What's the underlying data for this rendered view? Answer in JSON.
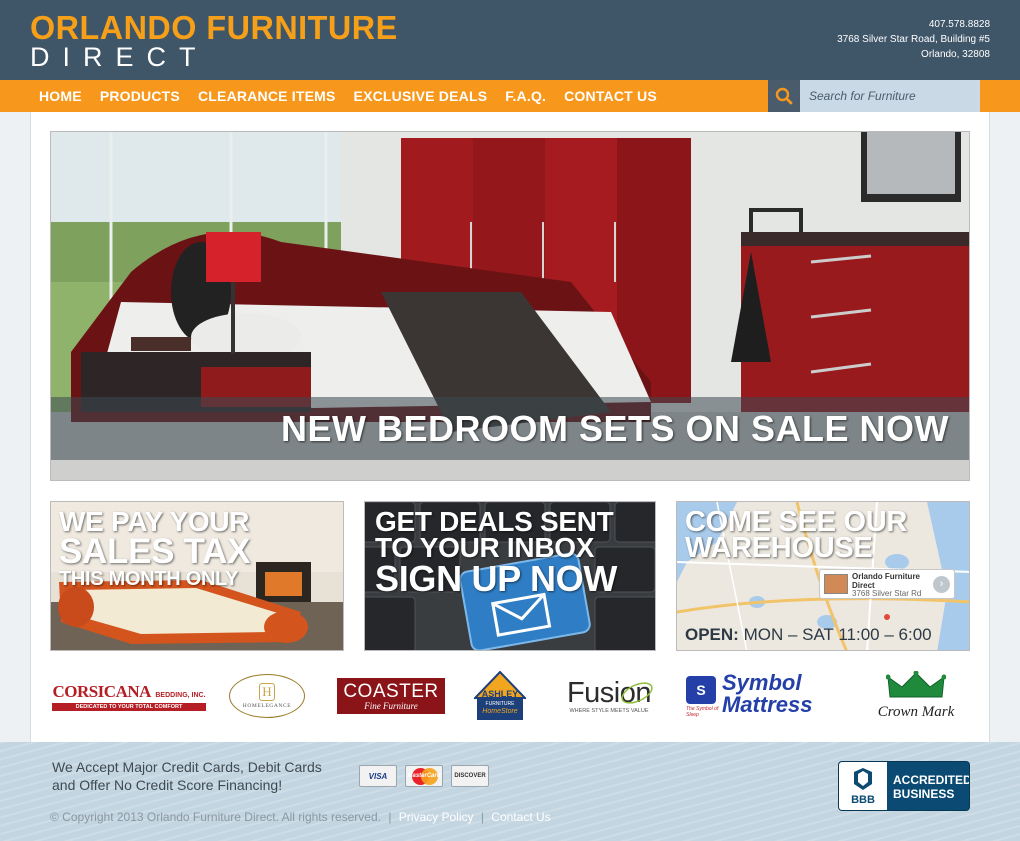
{
  "header": {
    "logo_line1": "ORLANDO FURNITURE",
    "logo_line2": "DIRECT",
    "phone": "407.578.8828",
    "address_line1": "3768 Silver Star Road, Building #5",
    "address_line2": "Orlando, 32808"
  },
  "nav": {
    "items": [
      {
        "label": "HOME"
      },
      {
        "label": "PRODUCTS"
      },
      {
        "label": "CLEARANCE ITEMS"
      },
      {
        "label": "EXCLUSIVE DEALS"
      },
      {
        "label": "F.A.Q."
      },
      {
        "label": "CONTACT US"
      }
    ]
  },
  "search": {
    "placeholder": "Search for Furniture",
    "icon": "search-icon"
  },
  "hero": {
    "caption": "NEW BEDROOM SETS ON SALE NOW"
  },
  "promos": {
    "tax": {
      "line1": "WE PAY YOUR",
      "line2": "SALES TAX",
      "line3": "THIS MONTH ONLY"
    },
    "deals": {
      "line1": "GET DEALS SENT",
      "line2": "TO YOUR INBOX",
      "line3": "SIGN UP NOW"
    },
    "warehouse": {
      "line1": "COME SEE OUR",
      "line2": "WAREHOUSE",
      "hours_label": "OPEN:",
      "hours_value": "MON – SAT 11:00 – 6:00",
      "map_pin_title": "Orlando Furniture Direct",
      "map_pin_address": "3768 Silver Star Rd"
    }
  },
  "brands": [
    {
      "name": "CORSICANA",
      "suffix": "BEDDING, INC.",
      "tagline": "DEDICATED TO YOUR TOTAL COMFORT"
    },
    {
      "name": "HOMELEGANCE"
    },
    {
      "name": "COASTER",
      "tagline": "Fine Furniture"
    },
    {
      "name": "ASHLEY",
      "sub1": "FURNITURE",
      "sub2": "HomeStore"
    },
    {
      "name": "Fusion",
      "tagline": "WHERE STYLE MEETS VALUE"
    },
    {
      "name": "Symbol",
      "name2": "Mattress",
      "tagline": "The Symbol of Sleep"
    },
    {
      "name": "Crown Mark"
    }
  ],
  "footer": {
    "payment_line1": "We Accept Major Credit Cards, Debit Cards",
    "payment_line2": "and Offer No Credit Score Financing!",
    "cards": [
      "VISA",
      "MasterCard",
      "DISCOVER"
    ],
    "copyright": "© Copyright 2013 Orlando Furniture Direct. All rights reserved.",
    "privacy_link": "Privacy Policy",
    "contact_link": "Contact Us",
    "bbb_logo": "BBB",
    "bbb_line1": "ACCREDITED",
    "bbb_line2": "BUSINESS"
  },
  "colors": {
    "header_bg": "#3f5568",
    "accent_orange": "#f7981d",
    "search_bg": "#c9d9e5",
    "bbb_blue": "#0b4b73"
  }
}
